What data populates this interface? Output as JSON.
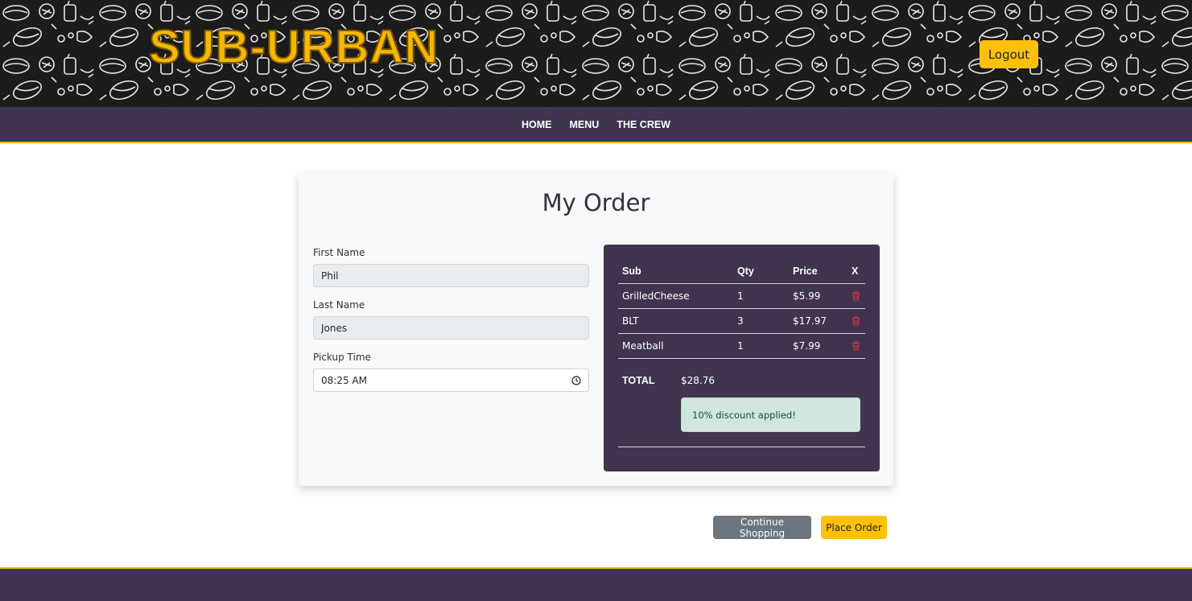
{
  "header": {
    "brand": "SUB-URBAN",
    "logout_label": "Logout"
  },
  "nav": {
    "items": [
      {
        "label": "HOME"
      },
      {
        "label": "MENU"
      },
      {
        "label": "THE CREW"
      }
    ]
  },
  "order_form": {
    "title": "My Order",
    "first_name_label": "First Name",
    "first_name_value": "Phil",
    "last_name_label": "Last Name",
    "last_name_value": "Jones",
    "pickup_label": "Pickup Time",
    "pickup_value": "08:25 AM"
  },
  "order_summary": {
    "headers": {
      "sub": "Sub",
      "qty": "Qty",
      "price": "Price",
      "remove": "X"
    },
    "rows": [
      {
        "sub": "GrilledCheese",
        "qty": "1",
        "price": "$5.99"
      },
      {
        "sub": "BLT",
        "qty": "3",
        "price": "$17.97"
      },
      {
        "sub": "Meatball",
        "qty": "1",
        "price": "$7.99"
      }
    ],
    "total_label": "TOTAL",
    "total_value": "$28.76",
    "discount_message": "10% discount applied!"
  },
  "actions": {
    "continue_label": "Continue Shopping",
    "place_order_label": "Place Order"
  },
  "colors": {
    "brand_yellow": "#ffc107",
    "nav_purple": "#41344f",
    "delete_red": "#dc3545",
    "success_bg": "#d1e7dd"
  },
  "icons": {
    "remove": "trash-icon",
    "time": "clock-icon"
  }
}
